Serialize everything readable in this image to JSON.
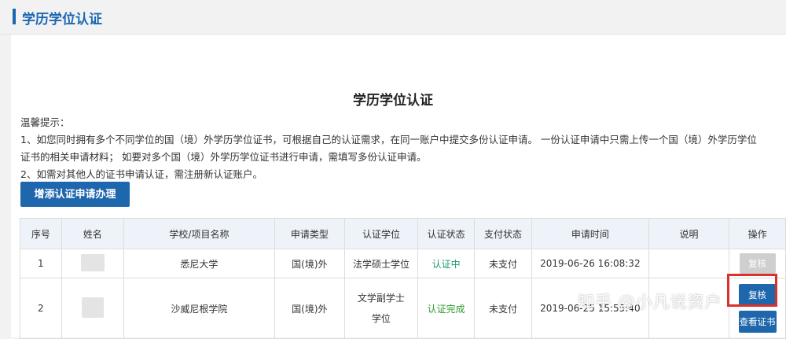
{
  "header": {
    "title": "学历学位认证"
  },
  "main": {
    "title": "学历学位认证",
    "tips": [
      "温馨提示：",
      "1、如您同时拥有多个不同学位的国（境）外学历学位证书，可根据自己的认证需求，在同一账户中提交多份认证申请。 一份认证申请中只需上传一个国（境）外学历学位",
      "证书的相关申请材料； 如要对多个国（境）外学历学位证书进行申请，需填写多份认证申请。",
      "2、如需对其他人的证书申请认证，需注册新认证账户。"
    ],
    "add_button": "增添认证申请办理"
  },
  "table": {
    "headers": [
      "序号",
      "姓名",
      "学校/项目名称",
      "申请类型",
      "认证学位",
      "认证状态",
      "支付状态",
      "申请时间",
      "说明",
      "操作"
    ],
    "rows": [
      {
        "no": "1",
        "school": "悉尼大学",
        "type": "国(境)外",
        "degree": "法学硕士学位",
        "status": "认证中",
        "payment": "未支付",
        "time": "2019-06-26 16:08:32",
        "note": "",
        "action": "复核"
      },
      {
        "no": "2",
        "school": "沙威尼根学院",
        "type": "国(境)外",
        "degree": "文学副学士学位",
        "status": "认证完成",
        "payment": "未支付",
        "time": "2019-06-25 15:55:40",
        "note": "",
        "action": "复核",
        "action2": "查看证书"
      }
    ]
  },
  "watermark": "知乎 @小凡说资户",
  "colors": {
    "brand_blue": "#1f67ad",
    "highlight_red": "#d9312b",
    "status_green": "#2f9c2f"
  }
}
